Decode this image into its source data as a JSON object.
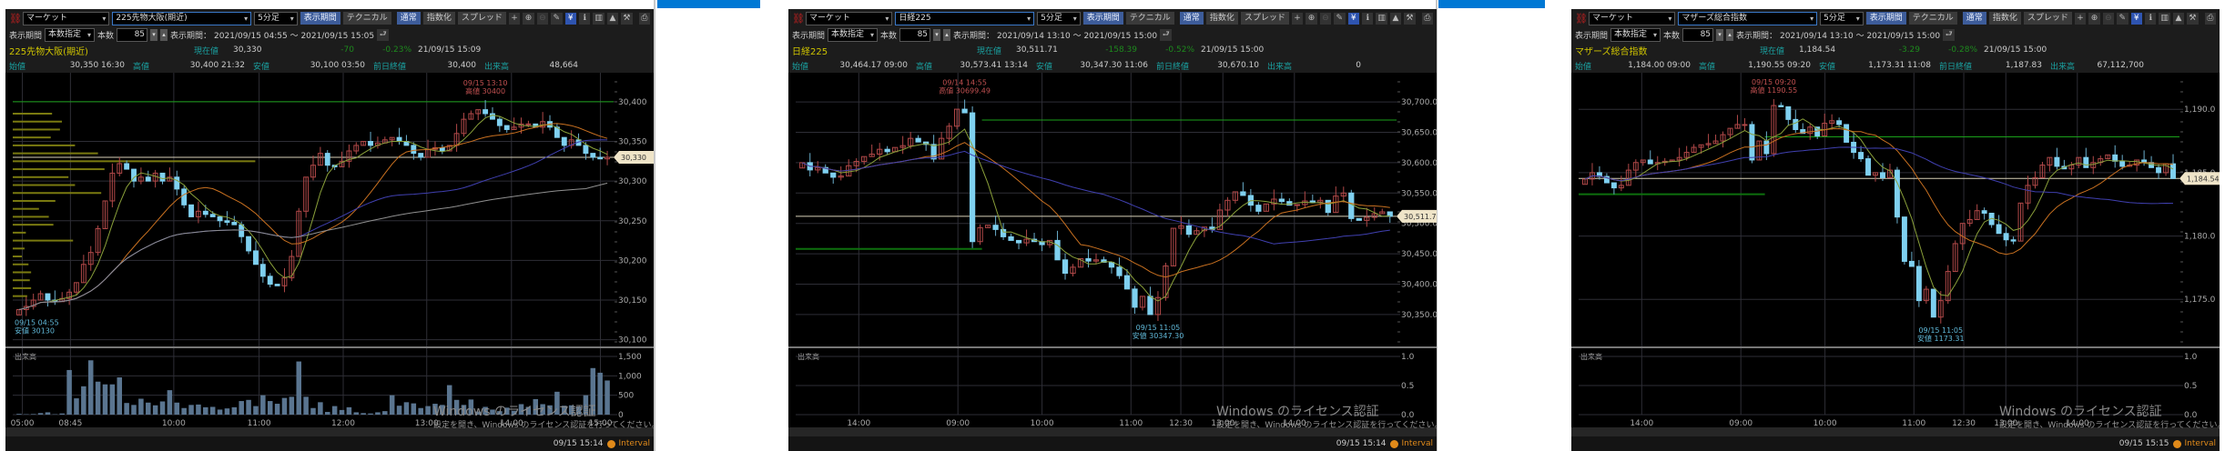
{
  "panels": [
    {
      "toolbar": {
        "market": "マーケット",
        "symbol": "225先物大阪(期近)",
        "interval": "5分足",
        "period_btn": "表示期間",
        "technical": "テクニカル",
        "normal": "通常",
        "index": "指数化",
        "spread": "スプレッド"
      },
      "period": {
        "label": "表示期間",
        "mode": "本数指定",
        "count_label": "本数",
        "count": "85",
        "range_label": "表示期間：",
        "range": "2021/09/15 04:55 ～ 2021/09/15 15:05"
      },
      "quote": {
        "name": "225先物大阪(期近)",
        "current_label": "現在値",
        "current": "30,330",
        "change": "-70",
        "change_pct": "-0.23%",
        "datetime": "21/09/15  15:09",
        "open_label": "始値",
        "open": "30,350 16:30",
        "high_label": "高値",
        "high": "30,400 21:32",
        "low_label": "安値",
        "low": "30,100 03:50",
        "prev_label": "前日終値",
        "prev": "30,400",
        "volume_label": "出来高",
        "volume": "48,664"
      },
      "watermark": {
        "title": "Windows のライセンス認証",
        "body": "設定を開き、Windows のライセンス認証を行ってください。"
      },
      "status": {
        "time": "09/15 15:14",
        "mode": "Interval"
      }
    },
    {
      "toolbar": {
        "market": "マーケット",
        "symbol": "日経225",
        "interval": "5分足",
        "period_btn": "表示期間",
        "technical": "テクニカル",
        "normal": "通常",
        "index": "指数化",
        "spread": "スプレッド"
      },
      "period": {
        "label": "表示期間",
        "mode": "本数指定",
        "count_label": "本数",
        "count": "85",
        "range_label": "表示期間：",
        "range": "2021/09/14 13:10 ～ 2021/09/15 15:00"
      },
      "quote": {
        "name": "日経225",
        "current_label": "現在値",
        "current": "30,511.71",
        "change": "-158.39",
        "change_pct": "-0.52%",
        "datetime": "21/09/15  15:00",
        "open_label": "始値",
        "open": "30,464.17 09:00",
        "high_label": "高値",
        "high": "30,573.41 13:14",
        "low_label": "安値",
        "low": "30,347.30 11:06",
        "prev_label": "前日終値",
        "prev": "30,670.10",
        "volume_label": "出来高",
        "volume": "0"
      },
      "watermark": {
        "title": "Windows のライセンス認証",
        "body": "設定を開き、Windows のライセンス認証を行ってください。"
      },
      "status": {
        "time": "09/15 15:14",
        "mode": "Interval"
      }
    },
    {
      "toolbar": {
        "market": "マーケット",
        "symbol": "マザーズ総合指数",
        "interval": "5分足",
        "period_btn": "表示期間",
        "technical": "テクニカル",
        "normal": "通常",
        "index": "指数化",
        "spread": "スプレッド"
      },
      "period": {
        "label": "表示期間",
        "mode": "本数指定",
        "count_label": "本数",
        "count": "85",
        "range_label": "表示期間：",
        "range": "2021/09/14 13:10 ～ 2021/09/15 15:00"
      },
      "quote": {
        "name": "マザーズ総合指数",
        "current_label": "現在値",
        "current": "1,184.54",
        "change": "-3.29",
        "change_pct": "-0.28%",
        "datetime": "21/09/15  15:00",
        "open_label": "始値",
        "open": "1,184.00 09:00",
        "high_label": "高値",
        "high": "1,190.55 09:20",
        "low_label": "安値",
        "low": "1,173.31 11:08",
        "prev_label": "前日終値",
        "prev": "1,187.83",
        "volume_label": "出来高",
        "volume": "67,112,700"
      },
      "watermark": {
        "title": "Windows のライセンス認証",
        "body": "設定を開き、Windows のライセンス認証を行ってください。"
      },
      "status": {
        "time": "09/15 15:15",
        "mode": "Interval"
      }
    }
  ],
  "chart_data": [
    {
      "type": "candlestick",
      "ylim": [
        30095,
        30432
      ],
      "y_ticks": [
        {
          "value": 30400,
          "label": "30,400"
        },
        {
          "value": 30350,
          "label": "30,350"
        },
        {
          "value": 30300,
          "label": "30,300"
        },
        {
          "value": 30250,
          "label": "30,250"
        },
        {
          "value": 30200,
          "label": "30,200"
        },
        {
          "value": 30150,
          "label": "30,150"
        },
        {
          "value": 30100,
          "label": "30,100"
        }
      ],
      "x_ticks": [
        "05:00",
        "08:45",
        "10:00",
        "11:00",
        "12:00",
        "13:00",
        "14:00",
        "15:00"
      ],
      "closes": [
        30138,
        30142,
        30150,
        30158,
        30150,
        30148,
        30152,
        30160,
        30172,
        30195,
        30210,
        30240,
        30275,
        30310,
        30322,
        30315,
        30300,
        30305,
        30300,
        30310,
        30300,
        30305,
        30290,
        30270,
        30255,
        30262,
        30258,
        30255,
        30250,
        30248,
        30245,
        30230,
        30212,
        30195,
        30180,
        30170,
        30168,
        30178,
        30205,
        30262,
        30305,
        30320,
        30335,
        30320,
        30318,
        30325,
        30338,
        30345,
        30350,
        30345,
        30348,
        30352,
        30355,
        30350,
        30345,
        30335,
        30330,
        30340,
        30342,
        30338,
        30345,
        30360,
        30378,
        30385,
        30390,
        30385,
        30378,
        30370,
        30365,
        30368,
        30372,
        30372,
        30368,
        30375,
        30368,
        30355,
        30345,
        30352,
        30345,
        30335,
        30330,
        30328,
        30330
      ],
      "volume_label": "出来高",
      "volume_ticks": [
        {
          "value": 1500,
          "label": "1,500"
        },
        {
          "value": 1000,
          "label": "1,000"
        },
        {
          "value": 500,
          "label": "500"
        },
        {
          "value": 0,
          "label": "0"
        }
      ],
      "volumes": [
        20,
        10,
        15,
        40,
        60,
        10,
        30,
        1150,
        420,
        730,
        1400,
        850,
        780,
        780,
        960,
        300,
        250,
        410,
        310,
        240,
        340,
        630,
        310,
        170,
        250,
        260,
        190,
        200,
        130,
        160,
        190,
        350,
        380,
        220,
        500,
        350,
        280,
        430,
        460,
        1370,
        460,
        170,
        320,
        70,
        220,
        120,
        190,
        60,
        40,
        30,
        60,
        90,
        500,
        230,
        320,
        290,
        170,
        220,
        280,
        250,
        760,
        380,
        250,
        390,
        80,
        200,
        130,
        90,
        180,
        100,
        270,
        200,
        400,
        270,
        240,
        590,
        230,
        240,
        210,
        500,
        1200,
        1080,
        880
      ],
      "prev_close_lines": [
        30400
      ],
      "current_price": {
        "value": 30330,
        "label": "30,330"
      },
      "high_annotation": {
        "time": "09/15 13:10",
        "label": "高値 30400"
      },
      "low_annotation": {
        "time": "09/15 04:55",
        "label": "安値 30130"
      },
      "price_volume_profile": [
        {
          "price": 30385,
          "value": 60
        },
        {
          "price": 30375,
          "value": 75
        },
        {
          "price": 30365,
          "value": 72
        },
        {
          "price": 30355,
          "value": 58
        },
        {
          "price": 30345,
          "value": 95
        },
        {
          "price": 30335,
          "value": 130
        },
        {
          "price": 30325,
          "value": 370
        },
        {
          "price": 30315,
          "value": 140
        },
        {
          "price": 30305,
          "value": 85
        },
        {
          "price": 30295,
          "value": 95
        },
        {
          "price": 30285,
          "value": 135
        },
        {
          "price": 30275,
          "value": 65
        },
        {
          "price": 30265,
          "value": 40
        },
        {
          "price": 30255,
          "value": 55
        },
        {
          "price": 30245,
          "value": 62
        },
        {
          "price": 30235,
          "value": 20
        },
        {
          "price": 30225,
          "value": 92
        },
        {
          "price": 30215,
          "value": 18
        },
        {
          "price": 30205,
          "value": 14
        },
        {
          "price": 30195,
          "value": 24
        },
        {
          "price": 30185,
          "value": 28
        },
        {
          "price": 30175,
          "value": 26
        },
        {
          "price": 30165,
          "value": 28
        },
        {
          "price": 30155,
          "value": 22
        }
      ],
      "colors": {
        "up": "#b04848",
        "down": "#7fd0f0",
        "ma_short": "#8aa03a",
        "ma_mid": "#c87020",
        "ma_long": "#4040b0",
        "ma_extra": "#909090",
        "prev_close": "#1aa01a",
        "volume": "#5a7590"
      }
    },
    {
      "type": "candlestick",
      "ylim": [
        30302,
        30742
      ],
      "y_ticks": [
        {
          "value": 30700,
          "label": "30,700.0"
        },
        {
          "value": 30650,
          "label": "30,650.0"
        },
        {
          "value": 30600,
          "label": "30,600.0"
        },
        {
          "value": 30550,
          "label": "30,550.0"
        },
        {
          "value": 30500,
          "label": "30,500.0"
        },
        {
          "value": 30450,
          "label": "30,450.0"
        },
        {
          "value": 30400,
          "label": "30,400.0"
        },
        {
          "value": 30350,
          "label": "30,350.0"
        }
      ],
      "x_ticks": [
        "14:00",
        "09:00",
        "10:00",
        "11:00",
        "12:30",
        "13:00",
        "14:00"
      ],
      "closes": [
        30600,
        30588,
        30592,
        30583,
        30576,
        30578,
        30595,
        30602,
        30610,
        30614,
        30622,
        30618,
        30625,
        30628,
        30640,
        30634,
        30630,
        30606,
        30640,
        30660,
        30688,
        30682,
        30470,
        30493,
        30497,
        30490,
        30478,
        30472,
        30468,
        30474,
        30470,
        30465,
        30472,
        30440,
        30418,
        30428,
        30442,
        30438,
        30440,
        30436,
        30428,
        30414,
        30392,
        30362,
        30380,
        30350,
        30378,
        30430,
        30492,
        30496,
        30482,
        30488,
        30494,
        30490,
        30522,
        30538,
        30552,
        30546,
        30530,
        30520,
        30532,
        30540,
        30536,
        30530,
        30531,
        30537,
        30535,
        30538,
        30518,
        30545,
        30550,
        30508,
        30505,
        30510,
        30516,
        30519,
        30511.71
      ],
      "volume_label": "出来高",
      "volume_ticks": [
        {
          "value": 1.0,
          "label": "1.0"
        },
        {
          "value": 0.5,
          "label": "0.5"
        },
        {
          "value": 0.0,
          "label": "0.0"
        }
      ],
      "volumes": [],
      "prev_close_lines": [
        30458,
        30670.1
      ],
      "current_price": {
        "value": 30511.71,
        "label": "30,511.71"
      },
      "high_annotation": {
        "time": "09/14 14:55",
        "label": "高値 30699.49"
      },
      "low_annotation": {
        "time": "09/15 11:05",
        "label": "安値 30347.30"
      },
      "colors": {
        "up": "#b04848",
        "down": "#7fd0f0",
        "ma_short": "#8aa03a",
        "ma_mid": "#c87020",
        "ma_long": "#4040b0",
        "prev_close": "#1aa01a",
        "volume": "#5a7590"
      }
    },
    {
      "type": "candlestick",
      "ylim": [
        1171.5,
        1192.6
      ],
      "y_ticks": [
        {
          "value": 1190,
          "label": "1,190.0"
        },
        {
          "value": 1185,
          "label": "1,185.0"
        },
        {
          "value": 1180,
          "label": "1,180.0"
        },
        {
          "value": 1175,
          "label": "1,175.0"
        }
      ],
      "x_ticks": [
        "14:00",
        "09:00",
        "10:00",
        "11:00",
        "12:30",
        "13:00",
        "14:00"
      ],
      "closes": [
        1184.5,
        1185.0,
        1184.7,
        1184.2,
        1183.8,
        1184.0,
        1185.2,
        1185.8,
        1186.0,
        1185.7,
        1185.8,
        1185.9,
        1186.0,
        1186.2,
        1186.6,
        1187.0,
        1187.2,
        1187.3,
        1187.5,
        1188.0,
        1188.5,
        1188.8,
        1188.8,
        1186.0,
        1187.5,
        1186.5,
        1190.3,
        1190.2,
        1189.2,
        1188.4,
        1188.1,
        1188.6,
        1187.9,
        1188.9,
        1189.1,
        1188.8,
        1187.4,
        1186.6,
        1186.1,
        1184.8,
        1185.0,
        1184.6,
        1185.2,
        1181.5,
        1178.0,
        1177.6,
        1174.9,
        1175.8,
        1173.6,
        1174.9,
        1177.2,
        1179.4,
        1181.0,
        1181.3,
        1182.0,
        1181.8,
        1180.9,
        1180.2,
        1179.7,
        1179.6,
        1182.6,
        1184.0,
        1184.6,
        1185.6,
        1186.2,
        1185.5,
        1185.3,
        1185.6,
        1186.2,
        1185.4,
        1185.8,
        1186.1,
        1186.4,
        1185.9,
        1185.5,
        1185.6,
        1186.0,
        1185.8,
        1185.4,
        1185.0,
        1185.7,
        1184.54
      ],
      "volume_label": "出来高",
      "volume_ticks": [
        {
          "value": 1.0,
          "label": "1.0"
        },
        {
          "value": 0.5,
          "label": "0.5"
        },
        {
          "value": 0.0,
          "label": "0.0"
        }
      ],
      "volumes": [],
      "prev_close_lines": [
        1183.3,
        1187.83
      ],
      "current_price": {
        "value": 1184.54,
        "label": "1,184.54"
      },
      "high_annotation": {
        "time": "09/15 09:20",
        "label": "高値 1190.55"
      },
      "low_annotation": {
        "time": "09/15 11:05",
        "label": "安値 1173.31"
      },
      "colors": {
        "up": "#b04848",
        "down": "#7fd0f0",
        "ma_short": "#8aa03a",
        "ma_mid": "#c87020",
        "ma_long": "#4040b0",
        "prev_close": "#1aa01a",
        "volume": "#5a7590"
      }
    }
  ]
}
